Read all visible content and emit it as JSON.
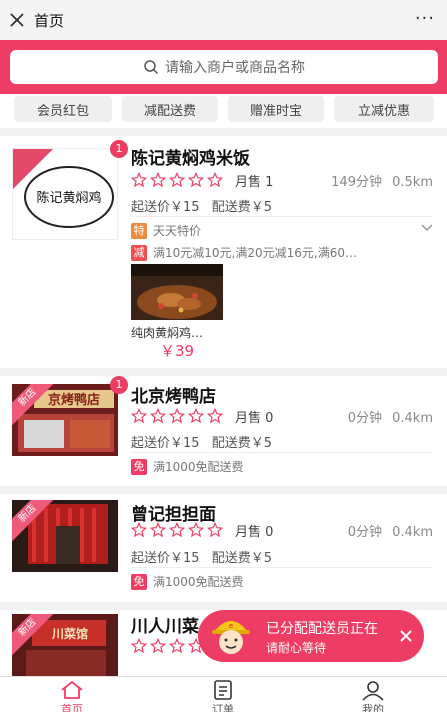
{
  "nav": {
    "title": "首页",
    "close_icon": "close-icon",
    "more_label": "···"
  },
  "search": {
    "placeholder": "请输入商户或商品名称"
  },
  "chips": [
    "会员红包",
    "减配送费",
    "赠准时宝",
    "立减优惠"
  ],
  "shops": [
    {
      "name": "陈记黄焖鸡米饭",
      "sign_text": "陈记黄焖鸡",
      "badge": "1",
      "rating": 0,
      "sales": "月售 1",
      "time": "149分钟",
      "distance": "0.5km",
      "min_price": "起送价￥15",
      "delivery": "配送费￥5",
      "promos": [
        {
          "tag": "特",
          "tag_color": "#f08a3c",
          "text": "天天特价"
        },
        {
          "tag": "减",
          "tag_color": "#ee5050",
          "text": "满10元减10元,满20元减16元,满60…"
        }
      ],
      "dish": {
        "name": "纯肉黄焖鸡…",
        "price": "￥39"
      }
    },
    {
      "name": "北京烤鸭店",
      "new_tag": "新店",
      "sign_text": "京烤鸭店",
      "badge": "1",
      "rating": 0,
      "sales": "月售 0",
      "time": "0分钟",
      "distance": "0.4km",
      "min_price": "起送价￥15",
      "delivery": "配送费￥5",
      "promos": [
        {
          "tag": "免",
          "tag_color": "#ee3d64",
          "text": "满1000免配送费"
        }
      ]
    },
    {
      "name": "曾记担担面",
      "new_tag": "新店",
      "rating": 0,
      "sales": "月售 0",
      "time": "0分钟",
      "distance": "0.4km",
      "min_price": "起送价￥15",
      "delivery": "配送费￥5",
      "promos": [
        {
          "tag": "免",
          "tag_color": "#ee3d64",
          "text": "满1000免配送费"
        }
      ]
    },
    {
      "name": "川人川菜",
      "new_tag": "新店",
      "sign_text": "川菜馆",
      "rating": 0
    }
  ],
  "toast": {
    "title": "已分配配送员正在",
    "subtitle": "请耐心等待"
  },
  "tabs": [
    "首页",
    "订单",
    "我的"
  ],
  "colors": {
    "accent": "#ee3d64",
    "star": "#ee3d64"
  }
}
